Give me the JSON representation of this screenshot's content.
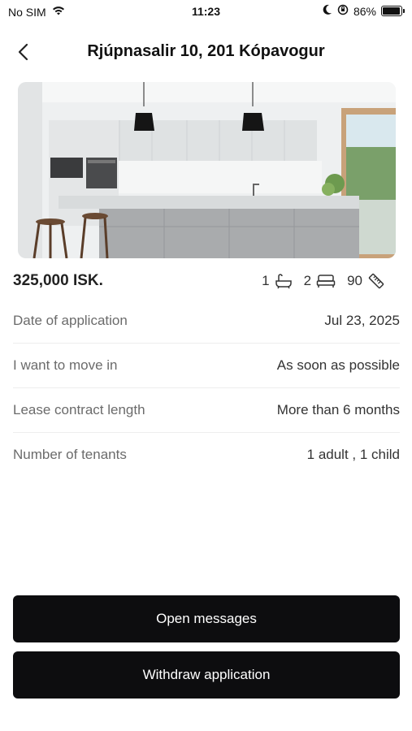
{
  "status_bar": {
    "carrier": "No SIM",
    "time": "11:23",
    "battery": "86%",
    "battery_level": 0.86
  },
  "header": {
    "title": "Rjúpnasalir 10, 201 Kópavogur",
    "back_icon": "chevron-left-icon"
  },
  "listing": {
    "price": "325,000 ISK.",
    "bathrooms": "1",
    "bedrooms": "2",
    "size": "90",
    "icons": [
      "bathtub-icon",
      "bed-icon",
      "ruler-icon"
    ]
  },
  "details": [
    {
      "label": "Date of application",
      "value": "Jul 23, 2025"
    },
    {
      "label": "I want to move in",
      "value": "As soon as possible"
    },
    {
      "label": "Lease contract length",
      "value": "More than 6 months"
    },
    {
      "label": "Number of tenants",
      "value": "1 adult , 1 child"
    }
  ],
  "actions": {
    "open_messages": "Open messages",
    "withdraw": "Withdraw application"
  },
  "colors": {
    "button_bg": "#0d0d0f",
    "label": "#6b6b6b",
    "value": "#333333"
  }
}
